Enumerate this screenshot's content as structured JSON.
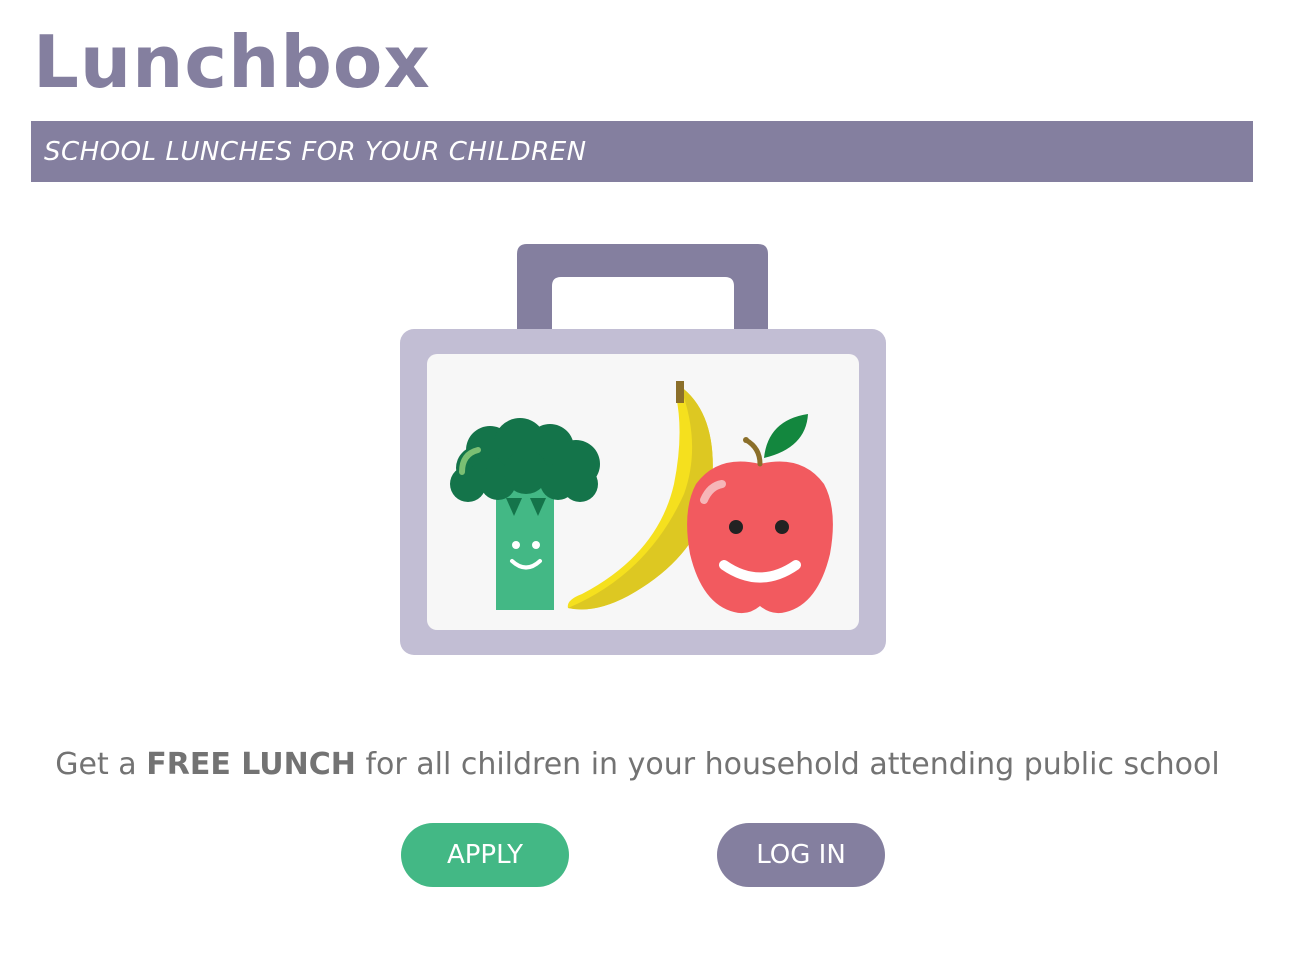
{
  "header": {
    "title": "Lunchbox",
    "tagline": "SCHOOL LUNCHES FOR YOUR CHILDREN"
  },
  "illustration": {
    "icon": "lunchbox-icon",
    "items": [
      "broccoli-icon",
      "banana-icon",
      "apple-icon"
    ]
  },
  "main": {
    "headline_prefix": "Get a ",
    "headline_emphasis": "FREE LUNCH",
    "headline_suffix": " for all children in your household attending public school"
  },
  "actions": {
    "apply_label": "APPLY",
    "login_label": "LOG IN"
  },
  "colors": {
    "brand": "#847f9f",
    "apply": "#43b885",
    "lunchbox_body": "#c2bed4",
    "broccoli_head": "#14744a",
    "banana": "#f5e01e",
    "apple": "#f25a5f"
  }
}
